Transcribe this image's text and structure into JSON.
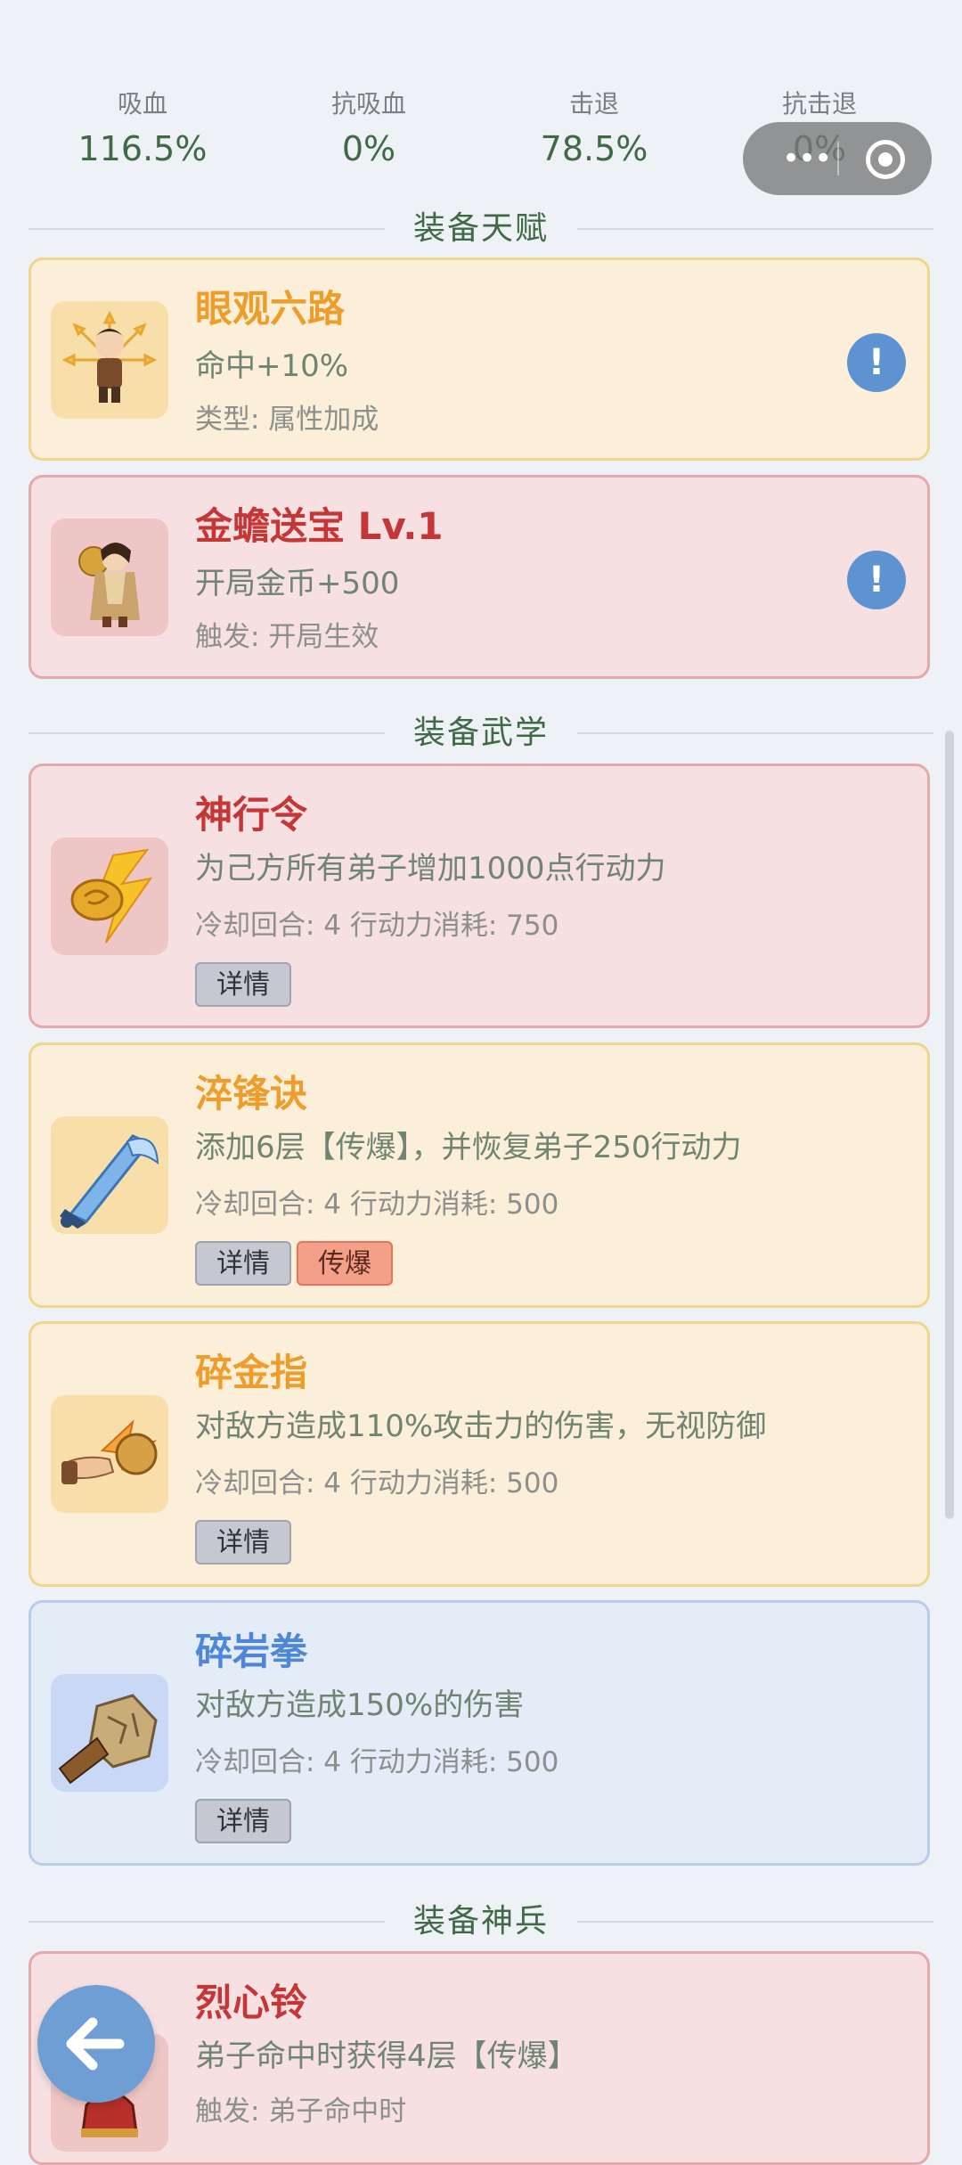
{
  "stats": [
    {
      "label": "吸血",
      "value": "116.5%"
    },
    {
      "label": "抗吸血",
      "value": "0%"
    },
    {
      "label": "击退",
      "value": "78.5%"
    },
    {
      "label": "抗击退",
      "value": "0%"
    }
  ],
  "capsule": {
    "menu_icon": "more-dots-icon",
    "close_icon": "target-close-icon"
  },
  "sections": {
    "talent": "装备天赋",
    "martial": "装备武学",
    "weapon": "装备神兵"
  },
  "talents": [
    {
      "name": "眼观六路",
      "desc": "命中+10%",
      "meta": "类型: 属性加成",
      "info": "!",
      "style": "yellow"
    },
    {
      "name": "金蟾送宝  Lv.1",
      "desc": "开局金币+500",
      "meta": "触发: 开局生效",
      "info": "!",
      "style": "red"
    }
  ],
  "skills": [
    {
      "name": "神行令",
      "desc": "为己方所有弟子增加1000点行动力",
      "meta": "冷却回合: 4  行动力消耗: 750",
      "tags": [
        "详情"
      ],
      "style": "red"
    },
    {
      "name": "淬锋诀",
      "desc": "添加6层【传爆】，并恢复弟子250行动力",
      "meta": "冷却回合: 4  行动力消耗: 500",
      "tags": [
        "详情",
        "传爆"
      ],
      "style": "yellow"
    },
    {
      "name": "碎金指",
      "desc": "对敌方造成110%攻击力的伤害，无视防御",
      "meta": "冷却回合: 4  行动力消耗: 500",
      "tags": [
        "详情"
      ],
      "style": "yellow"
    },
    {
      "name": "碎岩拳",
      "desc": "对敌方造成150%的伤害",
      "meta": "冷却回合: 4  行动力消耗: 500",
      "tags": [
        "详情"
      ],
      "style": "blue"
    }
  ],
  "weapons": [
    {
      "name": "烈心铃",
      "desc": "弟子命中时获得4层【传爆】",
      "meta": "触发: 弟子命中时",
      "style": "red"
    }
  ],
  "back_button": {
    "icon": "arrow-left-icon"
  }
}
